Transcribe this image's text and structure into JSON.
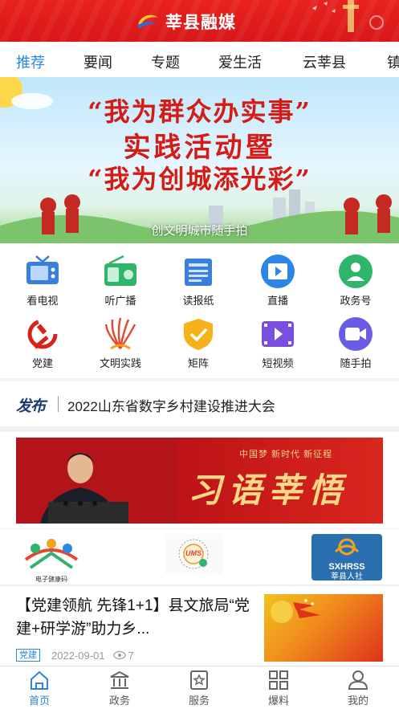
{
  "app": {
    "title": "莘县融媒"
  },
  "tabs": [
    {
      "label": "推荐",
      "active": true
    },
    {
      "label": "要闻",
      "active": false
    },
    {
      "label": "专题",
      "active": false
    },
    {
      "label": "爱生活",
      "active": false
    },
    {
      "label": "云莘县",
      "active": false
    },
    {
      "label": "镇",
      "active": false
    }
  ],
  "banner": {
    "slogan_line1": "“我为群众办实事”",
    "slogan_line2": "实践活动暨",
    "slogan_line3": "“我为创城添光彩”",
    "caption": "创文明城市随手拍"
  },
  "services": [
    {
      "label": "看电视",
      "icon": "tv-icon"
    },
    {
      "label": "听广播",
      "icon": "radio-icon"
    },
    {
      "label": "读报纸",
      "icon": "newspaper-icon"
    },
    {
      "label": "直播",
      "icon": "live-icon"
    },
    {
      "label": "政务号",
      "icon": "government-account-icon"
    },
    {
      "label": "党建",
      "icon": "party-emblem-icon"
    },
    {
      "label": "文明实践",
      "icon": "civilization-practice-icon"
    },
    {
      "label": "矩阵",
      "icon": "matrix-shield-icon"
    },
    {
      "label": "短视频",
      "icon": "short-video-icon"
    },
    {
      "label": "随手拍",
      "icon": "camera-icon"
    }
  ],
  "notice": {
    "tag": "发布",
    "text": "2022山东省数字乡村建设推进大会"
  },
  "feature": {
    "subtitle": "中国梦 新时代 新征程",
    "title": "习语莘悟"
  },
  "partners": [
    {
      "name": "electronic-health-code-logo",
      "caption": "电子健康码"
    },
    {
      "name": "ums-logo",
      "caption": "UMS"
    },
    {
      "name": "sxhrss-logo",
      "caption": "SXHRSS",
      "caption2": "莘县人社"
    }
  ],
  "news": {
    "headline": "【党建领航 先锋1+1】县文旅局“党建+研学游”助力乡...",
    "badge": "党建",
    "date": "2022-09-01",
    "views": "7"
  },
  "bottom_nav": [
    {
      "label": "首页",
      "icon": "home-icon",
      "active": true
    },
    {
      "label": "政务",
      "icon": "government-icon",
      "active": false
    },
    {
      "label": "服务",
      "icon": "service-icon",
      "active": false
    },
    {
      "label": "爆料",
      "icon": "tip-off-icon",
      "active": false
    },
    {
      "label": "我的",
      "icon": "profile-icon",
      "active": false
    }
  ],
  "colors": {
    "brand_red": "#e8231c",
    "accent_blue": "#2d86d9"
  }
}
